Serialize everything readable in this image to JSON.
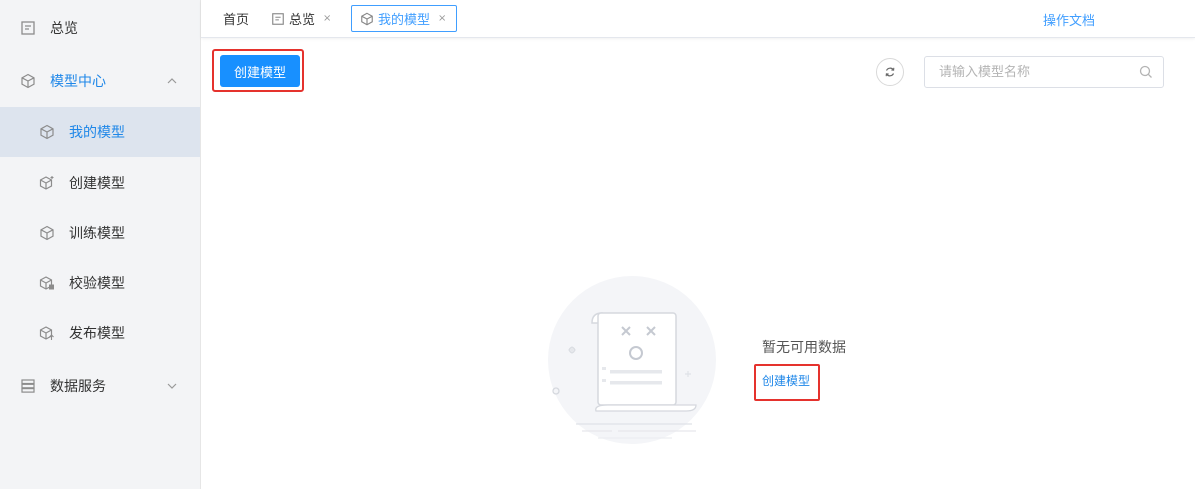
{
  "sidebar": {
    "overview": "总览",
    "model_center": "模型中心",
    "my_models": "我的模型",
    "create_model": "创建模型",
    "train_model": "训练模型",
    "validate_model": "校验模型",
    "publish_model": "发布模型",
    "data_service": "数据服务"
  },
  "tabs": {
    "home": "首页",
    "overview": "总览",
    "my_models": "我的模型",
    "close_glyph": "×"
  },
  "header": {
    "doc_link": "操作文档"
  },
  "toolbar": {
    "create_label": "创建模型",
    "search_placeholder": "请输入模型名称"
  },
  "empty_state": {
    "message": "暂无可用数据",
    "create_link": "创建模型"
  },
  "colors": {
    "primary": "#1890ff",
    "link": "#1f87e8",
    "highlight_border": "#e5322d",
    "sidebar_bg": "#f3f4f6",
    "active_bg": "#dde4ee"
  }
}
